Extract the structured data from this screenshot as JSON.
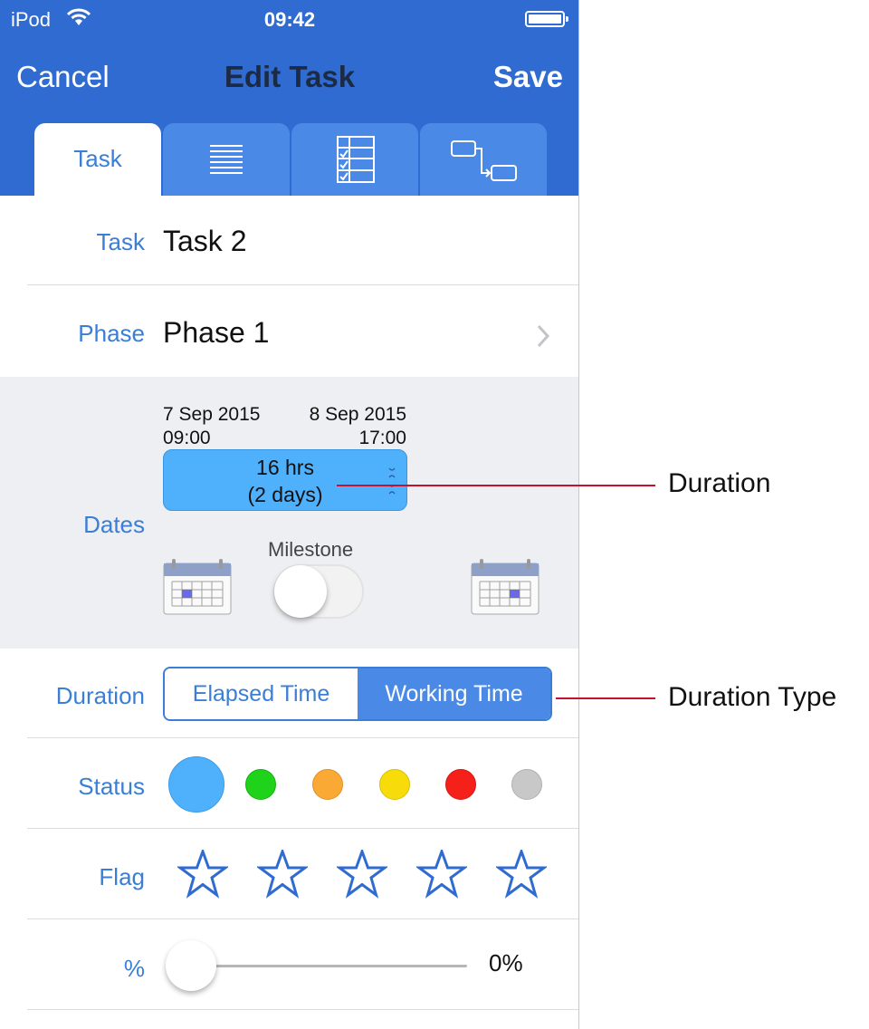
{
  "status_bar": {
    "carrier": "iPod",
    "time": "09:42"
  },
  "nav": {
    "cancel": "Cancel",
    "title": "Edit Task",
    "save": "Save"
  },
  "tabs": [
    {
      "label": "Task",
      "icon": "",
      "active": true
    },
    {
      "label": "",
      "icon": "notes-lines-icon",
      "active": false
    },
    {
      "label": "",
      "icon": "checklist-icon",
      "active": false
    },
    {
      "label": "",
      "icon": "dependency-link-icon",
      "active": false
    }
  ],
  "task": {
    "label": "Task",
    "value": "Task 2"
  },
  "phase": {
    "label": "Phase",
    "value": "Phase 1"
  },
  "dates": {
    "label": "Dates",
    "start_date": "7 Sep 2015",
    "start_time": "09:00",
    "end_date": "8 Sep 2015",
    "end_time": "17:00",
    "duration_line1": "16 hrs",
    "duration_line2": "(2 days)",
    "milestone_label": "Milestone",
    "milestone_on": false
  },
  "duration": {
    "label": "Duration",
    "options": [
      "Elapsed Time",
      "Working Time"
    ],
    "selected": "Working Time"
  },
  "status": {
    "label": "Status",
    "colors": [
      "#4fb0fb",
      "#1fd21a",
      "#fba935",
      "#f7dc0a",
      "#f5201a",
      "#c8c8c8"
    ],
    "selected_index": 0
  },
  "flag": {
    "label": "Flag",
    "count": 5
  },
  "percent": {
    "label": "%",
    "value_text": "0%",
    "value": 0
  },
  "callouts": {
    "duration": "Duration",
    "duration_type": "Duration Type"
  }
}
